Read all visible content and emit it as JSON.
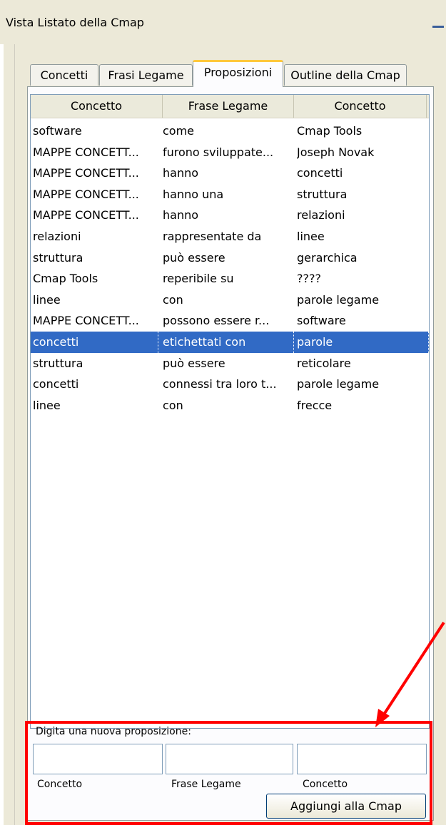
{
  "window": {
    "title": "Vista Listato della Cmap"
  },
  "tabs": [
    {
      "label": "Concetti",
      "active": false
    },
    {
      "label": "Frasi Legame",
      "active": false
    },
    {
      "label": "Proposizioni",
      "active": true
    },
    {
      "label": "Outline della Cmap",
      "active": false
    }
  ],
  "table": {
    "headers": [
      "Concetto",
      "Frase Legame",
      "Concetto"
    ],
    "rows": [
      [
        "software",
        "come",
        "Cmap Tools"
      ],
      [
        "MAPPE CONCETT...",
        "furono sviluppate...",
        "Joseph Novak"
      ],
      [
        "MAPPE CONCETT...",
        "hanno",
        "concetti"
      ],
      [
        "MAPPE CONCETT...",
        "hanno una",
        "struttura"
      ],
      [
        "MAPPE CONCETT...",
        "hanno",
        "relazioni"
      ],
      [
        "relazioni",
        "rappresentate da",
        "linee"
      ],
      [
        "struttura",
        "può essere",
        "gerarchica"
      ],
      [
        "Cmap Tools",
        "reperibile su",
        "????"
      ],
      [
        "linee",
        "con",
        "parole legame"
      ],
      [
        "MAPPE CONCETT...",
        "possono essere r...",
        "software"
      ],
      [
        "concetti",
        "etichettati con",
        "parole"
      ],
      [
        "struttura",
        "può essere",
        "reticolare"
      ],
      [
        "concetti",
        "connessi tra loro t...",
        "parole legame"
      ],
      [
        "linee",
        "con",
        "frecce"
      ]
    ],
    "selected_row": 10
  },
  "form": {
    "prompt": "Digita una nuova proposizione:",
    "fields": [
      {
        "label": "Concetto",
        "value": ""
      },
      {
        "label": "Frase Legame",
        "value": ""
      },
      {
        "label": "Concetto",
        "value": ""
      }
    ],
    "add_button": "Aggiungi alla Cmap"
  },
  "colors": {
    "selection": "#316ac5",
    "active_tab_accent": "#ffc83c",
    "annotation": "#ff0000"
  },
  "icons": {
    "minimize": "minimize-icon",
    "arrow": "arrow-icon"
  }
}
